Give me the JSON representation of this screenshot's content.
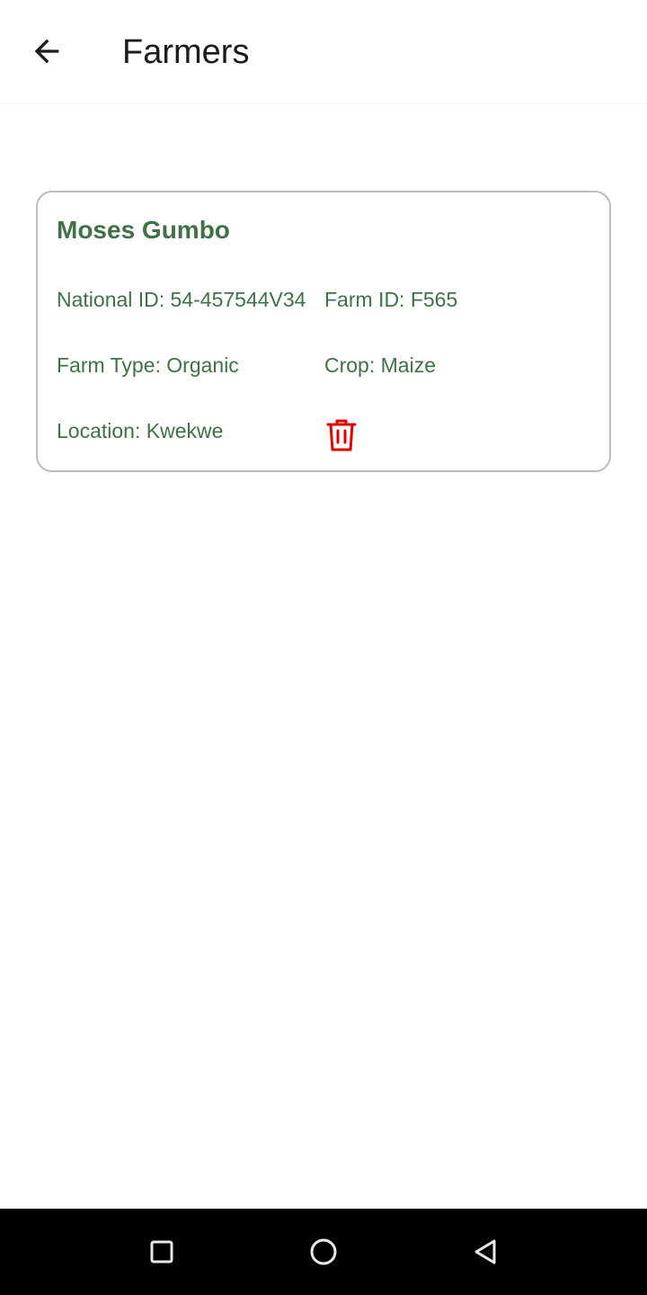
{
  "header": {
    "title": "Farmers",
    "back_icon": "arrow-left-icon"
  },
  "farmers": [
    {
      "name": "Moses Gumbo",
      "national_id": "National ID: 54-457544V34",
      "farm_id": "Farm ID: F565",
      "farm_type": "Farm Type: Organic",
      "crop": "Crop: Maize",
      "location": "Location: Kwekwe",
      "delete_icon": "trash-icon"
    }
  ],
  "colors": {
    "accent_green": "#3f7147",
    "delete_red": "#e00000",
    "card_border": "#bdbdbd",
    "title_text": "#1c1c1c",
    "nav_bar": "#000000"
  },
  "system_nav": {
    "recents_icon": "square-icon",
    "home_icon": "circle-icon",
    "back_icon": "triangle-back-icon"
  }
}
